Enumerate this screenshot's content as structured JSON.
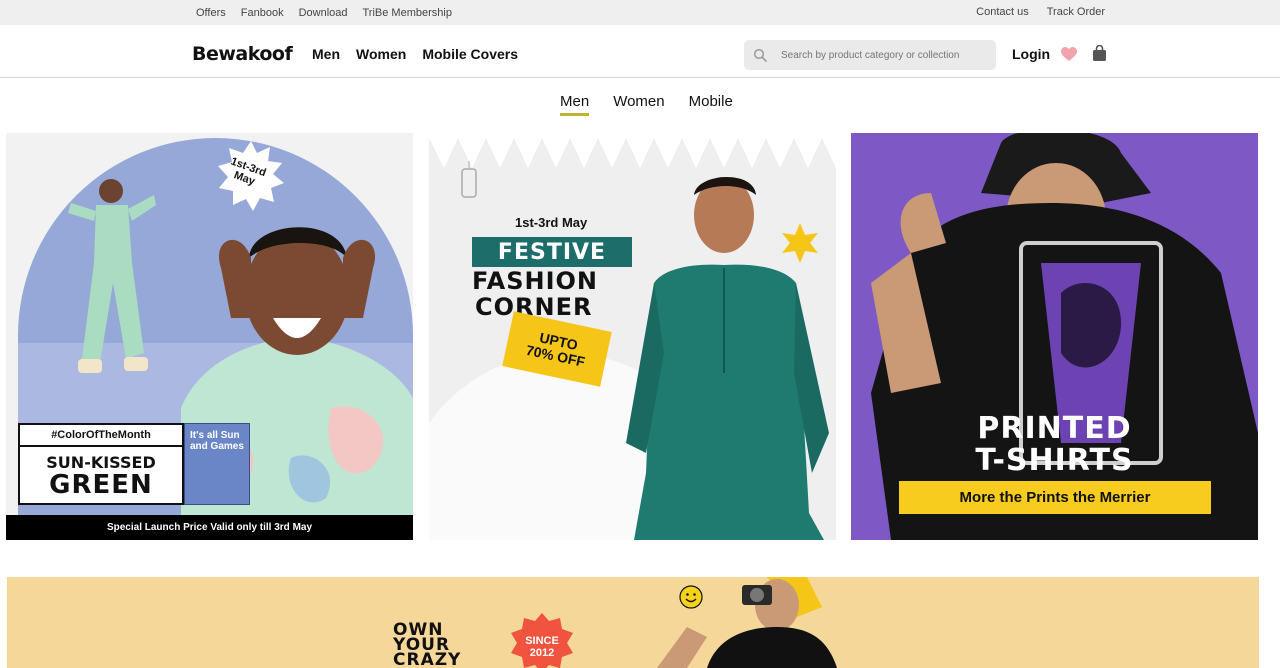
{
  "topbar": {
    "left_links": [
      "Offers",
      "Fanbook",
      "Download",
      "TriBe Membership"
    ],
    "right_links": [
      "Contact us",
      "Track Order"
    ]
  },
  "header": {
    "logo": "Bewakoof",
    "nav": [
      "Men",
      "Women",
      "Mobile Covers"
    ],
    "search_placeholder": "Search by product category or collection",
    "login": "Login"
  },
  "category_tabs": [
    {
      "label": "Men",
      "active": true
    },
    {
      "label": "Women",
      "active": false
    },
    {
      "label": "Mobile",
      "active": false
    }
  ],
  "banners": {
    "b1": {
      "date_line1": "1st-3rd",
      "date_line2": "May",
      "hashtag": "#ColorOfTheMonth",
      "title_line1": "SUN-KISSED",
      "title_line2": "GREEN",
      "side_text": "It's all Sun and Games",
      "strip": "Special Launch Price Valid only till 3rd May"
    },
    "b2": {
      "date": "1st-3rd May",
      "line1": "FESTIVE",
      "line2": "FASHION",
      "line3": "CORNER",
      "tag_line1": "UPTO",
      "tag_line2": "70% OFF"
    },
    "b3": {
      "title_line1": "PRINTED",
      "title_line2": "T-SHIRTS",
      "subtitle": "More the Prints the Merrier"
    }
  },
  "promo": {
    "line1": "OWN",
    "line2": "YOUR",
    "line3": "CRAZY",
    "since_line1": "SINCE",
    "since_line2": "2012"
  },
  "colors": {
    "tab_underline": "#bfb335",
    "festive_teal": "#1d6d6a",
    "promo_bg": "#f6d79a",
    "printed_bg": "#7e59c6",
    "merrier_yellow": "#f7cc1f"
  }
}
